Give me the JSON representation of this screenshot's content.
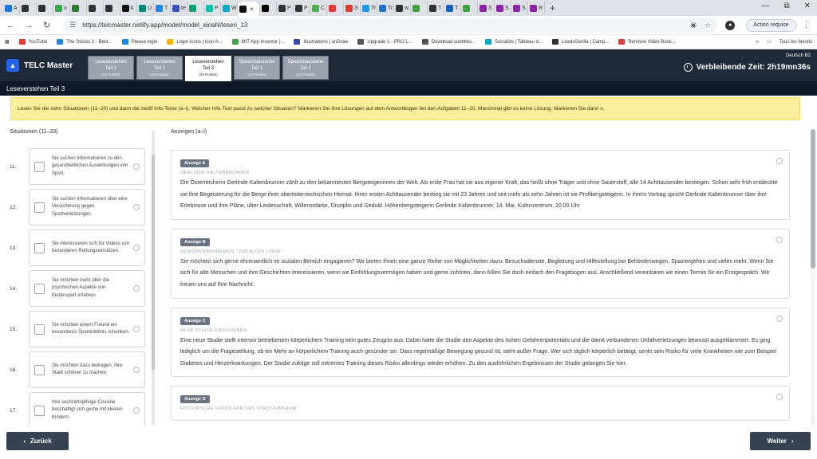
{
  "browser": {
    "tabs": [
      {
        "label": "A",
        "color": "#1a73e8"
      },
      {
        "label": "",
        "color": "#333333"
      },
      {
        "label": "",
        "color": "#333333"
      },
      {
        "label": "o",
        "color": "#34a853"
      },
      {
        "label": "",
        "color": "#2e7d32"
      },
      {
        "label": "",
        "color": "#333333"
      },
      {
        "label": "",
        "color": "#333333"
      },
      {
        "label": "k",
        "color": "#111111"
      },
      {
        "label": "U",
        "color": "#00897b"
      },
      {
        "label": "T",
        "color": "#1e88e5"
      },
      {
        "label": "te",
        "color": "#3f51b5"
      },
      {
        "label": "",
        "color": "#00a86b"
      },
      {
        "label": "P",
        "color": "#00bfa5"
      },
      {
        "label": "W",
        "color": "#00acc1"
      },
      {
        "label": "",
        "color": "#000000"
      },
      {
        "label": "P",
        "color": "#333333"
      },
      {
        "label": "P",
        "color": "#333333"
      },
      {
        "label": "C",
        "color": "#4caf50"
      },
      {
        "label": "",
        "color": "#e53935"
      },
      {
        "label": "S",
        "color": "#e53935"
      },
      {
        "label": "Tr",
        "color": "#2196f3"
      },
      {
        "label": "Tr",
        "color": "#1976d2"
      },
      {
        "label": "w",
        "color": "#333333"
      },
      {
        "label": "",
        "color": "#43a047"
      },
      {
        "label": "T",
        "color": "#333333"
      },
      {
        "label": "T",
        "color": "#1565c0"
      },
      {
        "label": "",
        "color": "#43a047"
      },
      {
        "label": "S",
        "color": "#8e24aa"
      },
      {
        "label": "S",
        "color": "#8e24aa"
      },
      {
        "label": "S",
        "color": "#8e24aa"
      },
      {
        "label": "R",
        "color": "#8e24aa"
      }
    ],
    "active_tab_label": "",
    "new_tab": "+",
    "url": "https://telcmaster.netlify.app/model/model_einahl/lesen_13",
    "action_button": "Action requise",
    "bookmarks": [
      {
        "label": "YouTube",
        "color": "#e53935"
      },
      {
        "label": "The Stocks 2 - Best...",
        "color": "#1e88e5"
      },
      {
        "label": "Please login",
        "color": "#1e88e5"
      },
      {
        "label": "Login Icons | Icon A...",
        "color": "#ffb300"
      },
      {
        "label": "MIT App Inventor |...",
        "color": "#43a047"
      },
      {
        "label": "Illustrations | unDraw",
        "color": "#3949ab"
      },
      {
        "label": "Upgrade 1 - PRO L...",
        "color": "#555555"
      },
      {
        "label": "Download subtitles...",
        "color": "#555555"
      },
      {
        "label": "Socialize | Tableau d...",
        "color": "#00acc1"
      },
      {
        "label": "LeadsGorilla | Camp...",
        "color": "#333333"
      },
      {
        "label": "Remove Video Back...",
        "color": "#e53935"
      }
    ],
    "all_bookmarks": "Tous les favoris"
  },
  "app": {
    "brand": "TELC Master",
    "tabs": [
      {
        "title": "Leseverstehen",
        "sub": "Teil 1",
        "pts": "(25 Punkte)",
        "active": false
      },
      {
        "title": "Leseverstehen",
        "sub": "Teil 2",
        "pts": "(25 Punkte)",
        "active": false
      },
      {
        "title": "Leseverstehen",
        "sub": "Teil 3",
        "pts": "(25 Punkte)",
        "active": true
      },
      {
        "title": "Sprachbausteine",
        "sub": "Teil 1",
        "pts": "(15 Punkte)",
        "active": false
      },
      {
        "title": "Sprachbausteine",
        "sub": "Teil 2",
        "pts": "(15 Punkte)",
        "active": false
      }
    ],
    "level": "Deutsch B2",
    "timer": "Verbleibende Zeit: 2h19mn36s",
    "section": "Leseverstehen Teil 3",
    "instruction": "Lesen Sie die zehn Situationen (11–20) und dann die zwölf Info-Texte (a–l). Welcher Info-Text passt zu welcher Situation? Markieren Sie Ihre Lösungen auf dem Antwortbogen bei den Aufgaben 11–20. Manchmal gibt es keine Lösung. Markieren Sie dann x."
  },
  "situations": {
    "header": "Situationen (11–20)",
    "items": [
      {
        "num": "11.",
        "text": "Sie suchen Informationen zu den gesundheitlichen Auswirkungen von Sport."
      },
      {
        "num": "12.",
        "text": "Sie suchen Informationen über eine Versicherung gegen Sportverletzungen."
      },
      {
        "num": "13.",
        "text": "Sie interessieren sich für Videos von besonderen Rettungseinsätzen."
      },
      {
        "num": "14.",
        "text": "Sie möchten mehr über die psychischen Aspekte von Klettersport erfahren."
      },
      {
        "num": "15.",
        "text": "Sie möchten einem Freund ein besonderes Sporterlebnis schenken."
      },
      {
        "num": "16.",
        "text": "Sie möchten dazu beitragen, Ihre Stadt schöner zu machen."
      },
      {
        "num": "17.",
        "text": "Ihre sechzehnjährige Cousine beschäftigt sich gerne mit kleinen Kindern."
      }
    ]
  },
  "ads": {
    "header": "Anzeigen (a–l)",
    "items": [
      {
        "badge": "Anzeige A",
        "title": "GERLINDE KALTENBRUNNER",
        "text": "Die Österreicherin Gerlinde Kaltenbrunner zählt zu den bekanntesten Bergsteigerinnen der Welt. Als erste Frau hat sie aus eigener Kraft, das heißt ohne Träger und ohne Sauerstoff, alle 14 Achttausender bestiegen. Schon sehr früh entdeckte sie ihre Begeisterung für die Berge ihrer oberösterreichischen Heimat. Ihren ersten Achttausender bestieg sie mit 23 Jahren und seit mehr als zehn Jahren ist sie Profibergsteigerin. In ihrem Vortrag spricht Gerlinde Kaltenbrunner über ihre Erlebnisse und ihre Pläne, über Leidenschaft, Willensstärke, Disziplin und Geduld. Höhenbergsteigerin Gerlinde Kaltenbrunner, 14. Mai, Kulturzentrum, 20.00 Uhr"
      },
      {
        "badge": "Anzeige B",
        "title": "SENIORENWOHNHAUS \"ZUR ALTEN LINDE\"",
        "text": "Sie möchten sich gerne ehrenamtlich im sozialen Bereich engagieren? Wir bieten Ihnen eine ganze Reihe von Möglichkeiten dazu: Besuchsdienste, Begleitung und Hilfestellung bei Behördenwegen, Spaziergehen und vieles mehr. Wenn Sie sich für alte Menschen und ihre Geschichten interessieren, wenn sie Einfühlungsvermögen haben und gerne zuhören, dann füllen Sie doch einfach den Fragebogen aus. Anschließend vereinbaren wir einen Termin für ein Erstgespräch. Wir freuen uns auf Ihre Nachricht."
      },
      {
        "badge": "Anzeige C",
        "title": "NEUE STUDIE ERSCHIENEN",
        "text": "Eine neue Studie stellt intensiv betriebenem körperlichem Training kein gutes Zeugnis aus. Dabei hatte die Studie den Aspekte des hohen Gefahrenpotentials und die damit verbundenen Unfallverletzungen bewusst ausgeklammert. Es ging lediglich um die Fragestellung, ob ein Mehr an körperlichem Training auch gesünder sei. Dass regelmäßige Bewegung gesund ist, steht außer Frage. Wer sich täglich körperlich betätigt, senkt sein Risiko für viele Krankheiten wie zum Beispiel Diabetes und Herzerkrankungen. Der Studie zufolge soll extremes Training dieses Risiko allerdings wieder erhöhen. Zu den ausführlichen Ergebnissen der Studie gelangen Sie hier."
      },
      {
        "badge": "Anzeige D",
        "title": "HISTORISCHE FOTOS FÜR DAS STADTJUBILÄUM",
        "text": ""
      }
    ]
  },
  "footer": {
    "back": "Zurück",
    "next": "Weiter"
  }
}
